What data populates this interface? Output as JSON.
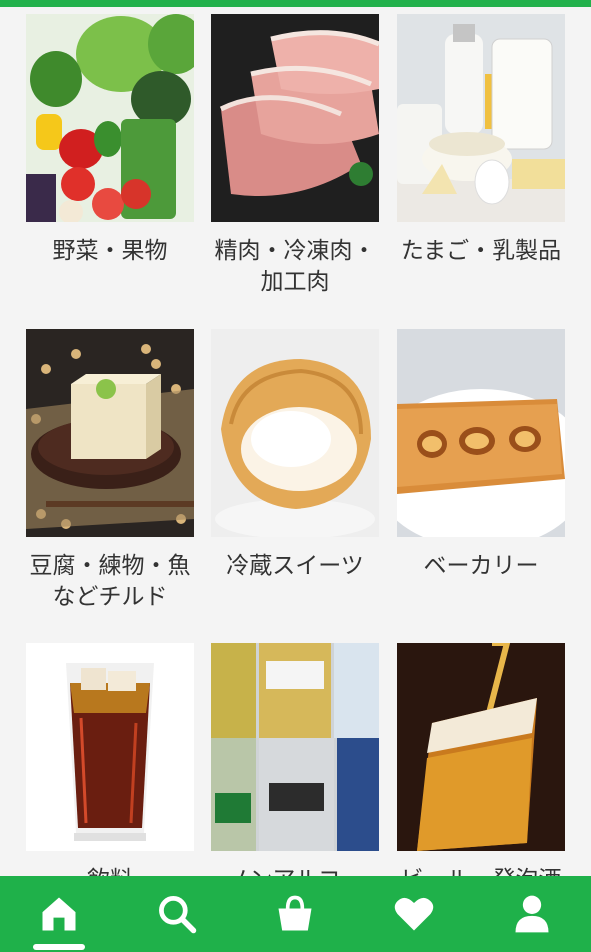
{
  "categories": [
    {
      "label": "野菜・果物"
    },
    {
      "label": "精肉・冷凍肉・\n加工肉"
    },
    {
      "label": "たまご・乳製品"
    },
    {
      "label": "豆腐・練物・魚\nなどチルド"
    },
    {
      "label": "冷蔵スイーツ"
    },
    {
      "label": "ベーカリー"
    },
    {
      "label": "飲料"
    },
    {
      "label": "ノンアルコー"
    },
    {
      "label": "ビール・発泡酒"
    }
  ],
  "nav": {
    "items": [
      {
        "icon": "home-icon",
        "active": true
      },
      {
        "icon": "search-icon"
      },
      {
        "icon": "cart-bag-icon"
      },
      {
        "icon": "heart-icon"
      },
      {
        "icon": "user-icon"
      }
    ]
  },
  "colors": {
    "accent": "#22b14c",
    "nav_bg": "#1fb14a",
    "label": "#333333"
  }
}
